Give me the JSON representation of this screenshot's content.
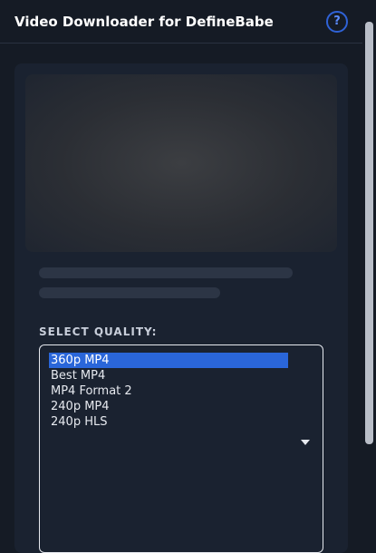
{
  "header": {
    "title": "Video Downloader for DefineBabe",
    "help_icon": "?"
  },
  "quality": {
    "label": "SELECT QUALITY:",
    "options": [
      "360p MP4",
      "Best MP4",
      "MP4 Format 2",
      "240p MP4",
      "240p HLS"
    ],
    "selected": "360p MP4"
  },
  "colors": {
    "accent": "#2a66d9",
    "background": "#151b25",
    "card": "#1a2230"
  }
}
